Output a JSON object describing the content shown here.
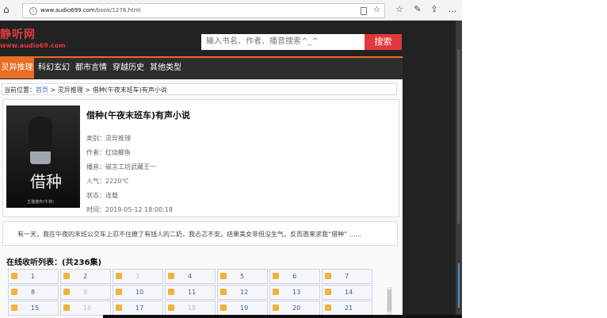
{
  "browser": {
    "url_host": "www.audio699.com",
    "url_path": "/book/1276.html"
  },
  "site": {
    "logo_title": "静听网",
    "logo_url": "www.audio69.com",
    "search_placeholder": "输入书名、作者、播音搜索^_^",
    "search_button": "搜索"
  },
  "nav": [
    "灵异推理",
    "科幻玄幻",
    "都市言情",
    "穿越历史",
    "其他类型"
  ],
  "breadcrumb": {
    "prefix": "当前位置：",
    "home": "首页",
    "sep1": " > ",
    "category": "灵异推理",
    "sep2": " > ",
    "current": "借种(午夜末班车)有声小说"
  },
  "book": {
    "cover_title": "借种",
    "cover_caption": "五猫猫传(午夜)",
    "title": "借种(午夜末班车)有声小说",
    "meta": [
      {
        "label": "类别：",
        "value": "灵异推理"
      },
      {
        "label": "作者：",
        "value": "红烧鲫鱼"
      },
      {
        "label": "播音：",
        "value": "磁言工坊武藏王一"
      },
      {
        "label": "人气：",
        "value": "2220℃"
      },
      {
        "label": "状态：",
        "value": "连载"
      },
      {
        "label": "时间：",
        "value": "2019-05-12 18:00:18"
      }
    ],
    "description": "有一天，我在午夜的末班公交车上忍不住撩了有钱人的二奶，我忐忑不安。结果美女非但没生气，反而邀来求我“借种”   ......"
  },
  "episodes": {
    "title": "在线收听列表：(共236集)",
    "items": [
      "1",
      "2",
      "3",
      "4",
      "5",
      "6",
      "7",
      "8",
      "9",
      "10",
      "11",
      "12",
      "13",
      "14",
      "15",
      "16",
      "17",
      "18",
      "19",
      "20",
      "21"
    ],
    "dimmed": [
      "3",
      "9",
      "16",
      "18"
    ]
  },
  "icons": [
    "home-icon",
    "info-icon",
    "reader-icon",
    "star-icon",
    "favorites-icon",
    "read-aloud-icon",
    "share-icon",
    "more-icon",
    "audio-icon"
  ]
}
